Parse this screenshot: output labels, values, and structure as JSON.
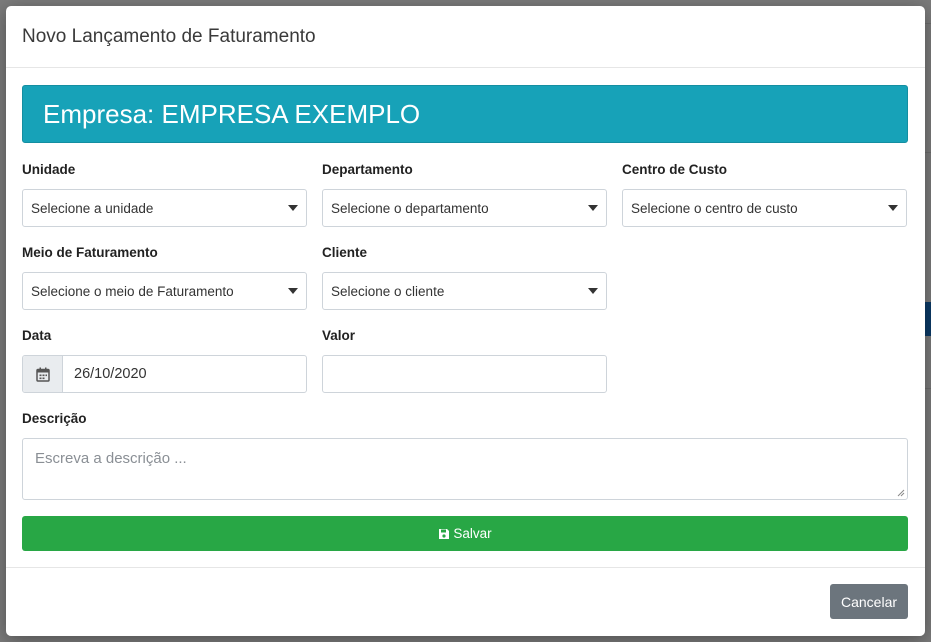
{
  "modal": {
    "title": "Novo Lançamento de Faturamento",
    "banner": "Empresa: EMPRESA EXEMPLO"
  },
  "form": {
    "unidade": {
      "label": "Unidade",
      "value": "Selecione a unidade"
    },
    "departamento": {
      "label": "Departamento",
      "value": "Selecione o departamento"
    },
    "centro_custo": {
      "label": "Centro de Custo",
      "value": "Selecione o centro de custo"
    },
    "meio_faturamento": {
      "label": "Meio de Faturamento",
      "value": "Selecione o meio de Faturamento"
    },
    "cliente": {
      "label": "Cliente",
      "value": "Selecione o cliente"
    },
    "data": {
      "label": "Data",
      "value": "26/10/2020"
    },
    "valor": {
      "label": "Valor",
      "value": ""
    },
    "descricao": {
      "label": "Descrição",
      "placeholder": "Escreva a descrição ..."
    }
  },
  "buttons": {
    "save": "Salvar",
    "cancel": "Cancelar"
  },
  "colors": {
    "banner": "#17a2b8",
    "save": "#28a745",
    "cancel": "#6c757d"
  },
  "icons": {
    "calendar": "calendar-icon",
    "save": "floppy-disk-icon",
    "caret": "caret-down-icon"
  }
}
